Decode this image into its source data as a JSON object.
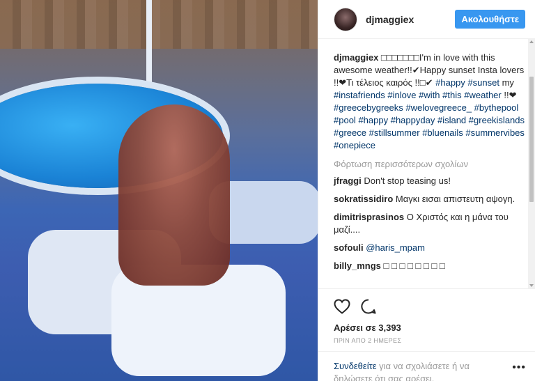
{
  "header": {
    "username": "djmaggiex",
    "follow_label": "Ακολουθήστε"
  },
  "caption": {
    "username": "djmaggiex",
    "text_start": " □□□□□□□I'm in love with this awesome weather!!✔Happy sunset Insta lovers !!❤Τι τέλειος καιρός !!□✔ ",
    "tags_line1": [
      "#happy",
      "#sunset"
    ],
    "my_word": "my",
    "tags_line2": [
      "#instafriends",
      "#inlove",
      "#with",
      "#this",
      "#weather"
    ],
    "heart_text": "!!❤",
    "tags_line3": [
      "#greecebygreeks",
      "#welovegreece_",
      "#bythepool",
      "#pool",
      "#happy",
      "#happyday",
      "#island",
      "#greekislands",
      "#greece",
      "#stillsummer",
      "#bluenails",
      "#summervibes",
      "#onepiece"
    ]
  },
  "load_more": "Φόρτωση περισσότερων σχολίων",
  "comments": [
    {
      "username": "jfraggi",
      "text": "Don't stop teasing us!"
    },
    {
      "username": "sokratissidiro",
      "text": "Μαγκι εισαι απιστευτη αψογη."
    },
    {
      "username": "dimitrisprasinos",
      "text": "Ο Χριστός και η μάνα του μαζί...."
    },
    {
      "username": "sofouli",
      "mention": "@haris_mpam",
      "text": ""
    },
    {
      "username": "billy_mngs",
      "text": "□ □ □ □ □ □ □ □"
    }
  ],
  "actions": {
    "like_icon": "heart-icon",
    "comment_icon": "comment-icon"
  },
  "likes_text": "Αρέσει σε 3,393",
  "time_text": "ΠΡΙΝ ΑΠΟ 2 ΗΜΕΡΕΣ",
  "login": {
    "link_text": "Συνδεθείτε",
    "rest_text": " για να σχολιάσετε ή να δηλώσετε ότι σας αρέσει."
  },
  "more_options": "•••",
  "colors": {
    "follow_button": "#3897f0",
    "hashtag": "#003569",
    "muted": "#999999"
  }
}
